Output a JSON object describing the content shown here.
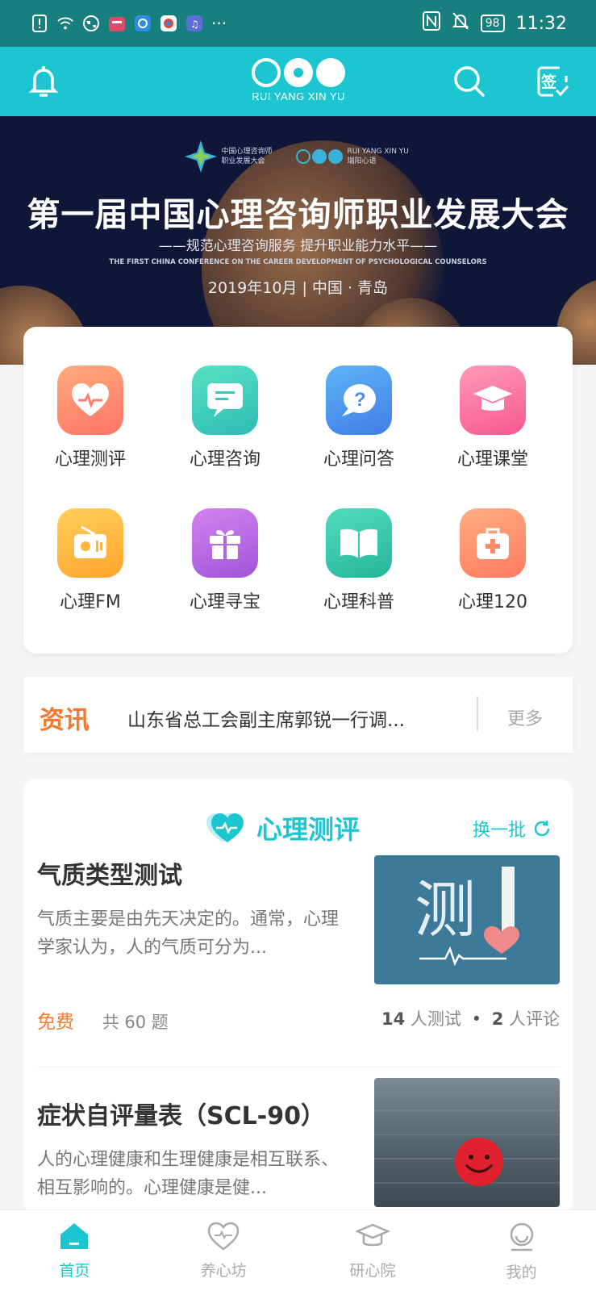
{
  "status_bar": {
    "time": "11:32",
    "battery": "98",
    "more": "···"
  },
  "header": {
    "logo_text": "RUI YANG XIN YU",
    "sign_label": "签"
  },
  "banner": {
    "org_logo_text": "中国心理咨询师 职业发展大会",
    "brand_logo_text": "RUI YANG XIN YU 瑞阳心语",
    "title": "第一届中国心理咨询师职业发展大会",
    "subtitle": "——规范心理咨询服务 提升职业能力水平——",
    "english": "THE FIRST CHINA CONFERENCE ON THE CAREER DEVELOPMENT OF PSYCHOLOGICAL COUNSELORS",
    "date": "2019年10月 | 中国 · 青岛"
  },
  "grid": [
    {
      "label": "心理测评",
      "icon": "heart-pulse-icon",
      "color": "#ff8a6c"
    },
    {
      "label": "心理咨询",
      "icon": "chat-icon",
      "color": "#3ccdb7"
    },
    {
      "label": "心理问答",
      "icon": "question-icon",
      "color": "#4a8df0"
    },
    {
      "label": "心理课堂",
      "icon": "graduation-cap-icon",
      "color": "#f86c9a"
    },
    {
      "label": "心理FM",
      "icon": "radio-icon",
      "color": "#ffb43d"
    },
    {
      "label": "心理寻宝",
      "icon": "gift-icon",
      "color": "#b167e0"
    },
    {
      "label": "心理科普",
      "icon": "book-icon",
      "color": "#36c4a6"
    },
    {
      "label": "心理120",
      "icon": "first-aid-icon",
      "color": "#ff8a6c"
    }
  ],
  "news": {
    "tag": "资讯",
    "headline": "山东省总工会副主席郭锐一行调...",
    "more": "更多"
  },
  "tests": {
    "title": "心理测评",
    "refresh": "换一批",
    "items": [
      {
        "title": "气质类型测试",
        "desc": "气质主要是由先天决定的。通常，心理学家认为，人的气质可分为...",
        "price": "免费",
        "count": "共 60 题",
        "testers": "14",
        "testers_label": "人测试",
        "dot": "•",
        "comments": "2",
        "comments_label": "人评论",
        "image_text": "测"
      },
      {
        "title": "症状自评量表（SCL-90）",
        "desc": "人的心理健康和生理健康是相互联系、相互影响的。心理健康是健..."
      }
    ]
  },
  "nav": [
    {
      "label": "首页",
      "icon": "home-icon"
    },
    {
      "label": "养心坊",
      "icon": "heart-icon"
    },
    {
      "label": "研心院",
      "icon": "graduation-cap-icon"
    },
    {
      "label": "我的",
      "icon": "profile-icon"
    }
  ],
  "colors": {
    "accent": "#1cc6d1",
    "orange": "#f07a2f",
    "status_bar": "#17807f"
  }
}
